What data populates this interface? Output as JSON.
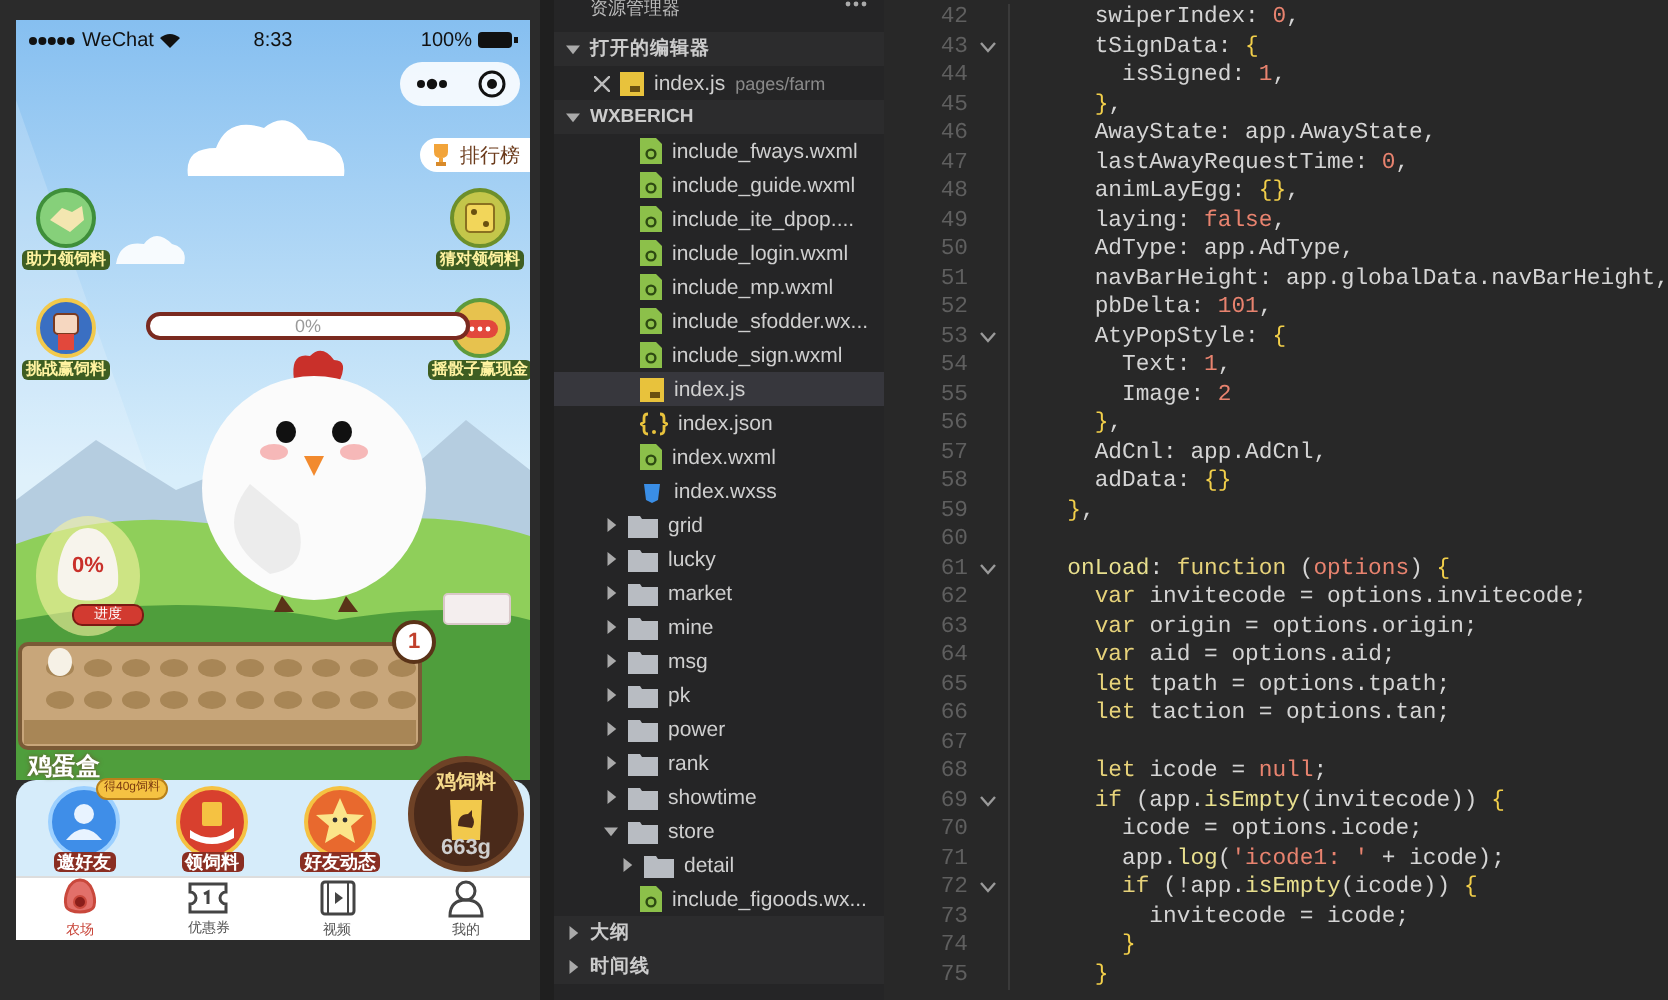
{
  "phone": {
    "status_bar": {
      "carrier": "WeChat",
      "time": "8:33",
      "battery": "100%"
    },
    "rank_button": "排行榜",
    "left_buttons": [
      {
        "kind": "handshake",
        "label": "助力领饲料"
      },
      {
        "kind": "fist",
        "label": "挑战赢饲料"
      }
    ],
    "right_buttons": [
      {
        "kind": "dice",
        "label": "猜对领饲料"
      },
      {
        "kind": "chat",
        "label": "摇骰子赢现金"
      }
    ],
    "progress": {
      "text": "0%",
      "level": 0
    },
    "egg": {
      "text": "0%",
      "label": "进度"
    },
    "tray": {
      "label": "鸡蛋盒",
      "badge": "1"
    },
    "feed": {
      "title": "鸡饲料",
      "amount": "663g"
    },
    "actions": [
      {
        "kind": "invite",
        "label": "邀好友",
        "badge": "得40g饲料"
      },
      {
        "kind": "feed",
        "label": "领饲料"
      },
      {
        "kind": "moments",
        "label": "好友动态"
      }
    ],
    "tab_bar": [
      {
        "kind": "farm",
        "label": "农场",
        "selected": true
      },
      {
        "kind": "coupon",
        "label": "优惠券",
        "selected": false
      },
      {
        "kind": "video",
        "label": "视频",
        "selected": false
      },
      {
        "kind": "profile",
        "label": "我的",
        "selected": false
      }
    ]
  },
  "explorer": {
    "title": "资源管理器",
    "open_editors": {
      "title": "打开的编辑器",
      "expanded": true,
      "files": [
        {
          "name": "index.js",
          "path": "pages/farm",
          "kind": "js"
        }
      ]
    },
    "project": {
      "title": "WXBERICH",
      "expanded": true,
      "scrolled_folder_children": [
        {
          "name": "include_fways.wxml",
          "kind": "wxml",
          "selected": false
        },
        {
          "name": "include_guide.wxml",
          "kind": "wxml",
          "selected": false
        },
        {
          "name": "include_ite_dpop....",
          "kind": "wxml",
          "selected": false
        },
        {
          "name": "include_login.wxml",
          "kind": "wxml",
          "selected": false
        },
        {
          "name": "include_mp.wxml",
          "kind": "wxml",
          "selected": false
        },
        {
          "name": "include_sfodder.wx...",
          "kind": "wxml",
          "selected": false
        },
        {
          "name": "include_sign.wxml",
          "kind": "wxml",
          "selected": false
        },
        {
          "name": "index.js",
          "kind": "js",
          "selected": true
        },
        {
          "name": "index.json",
          "kind": "json",
          "selected": false
        },
        {
          "name": "index.wxml",
          "kind": "wxml",
          "selected": false
        },
        {
          "name": "index.wxss",
          "kind": "wxss",
          "selected": false
        }
      ],
      "items": [
        {
          "name": "grid",
          "kind": "folder",
          "expanded": false,
          "selected": false
        },
        {
          "name": "lucky",
          "kind": "folder",
          "expanded": false,
          "selected": false
        },
        {
          "name": "market",
          "kind": "folder",
          "expanded": false,
          "selected": false
        },
        {
          "name": "mine",
          "kind": "folder",
          "expanded": false,
          "selected": false
        },
        {
          "name": "msg",
          "kind": "folder",
          "expanded": false,
          "selected": false
        },
        {
          "name": "pk",
          "kind": "folder",
          "expanded": false,
          "selected": false
        },
        {
          "name": "power",
          "kind": "folder",
          "expanded": false,
          "selected": false
        },
        {
          "name": "rank",
          "kind": "folder",
          "expanded": false,
          "selected": false
        },
        {
          "name": "showtime",
          "kind": "folder",
          "expanded": false,
          "selected": false
        },
        {
          "name": "store",
          "kind": "folder",
          "expanded": true,
          "selected": false,
          "children": [
            {
              "name": "detail",
              "kind": "folder",
              "expanded": false,
              "selected": false
            },
            {
              "name": "include_figoods.wx...",
              "kind": "wxml",
              "selected": false
            }
          ]
        }
      ]
    },
    "panels": [
      {
        "title": "大纲",
        "expanded": false
      },
      {
        "title": "时间线",
        "expanded": false
      }
    ]
  },
  "editor": {
    "lines": [
      {
        "number": "42",
        "fold": false,
        "segments": [
          {
            "text": "    swiperIndex: ",
            "kind": "plain"
          },
          {
            "text": "0",
            "kind": "literal"
          },
          {
            "text": ",",
            "kind": "plain"
          }
        ]
      },
      {
        "number": "43",
        "fold": true,
        "segments": [
          {
            "text": "    tSignData: ",
            "kind": "plain"
          },
          {
            "text": "{",
            "kind": "brace"
          }
        ]
      },
      {
        "number": "44",
        "fold": false,
        "segments": [
          {
            "text": "      isSigned: ",
            "kind": "plain"
          },
          {
            "text": "1",
            "kind": "literal"
          },
          {
            "text": ",",
            "kind": "plain"
          }
        ]
      },
      {
        "number": "45",
        "fold": false,
        "segments": [
          {
            "text": "    }",
            "kind": "brace"
          },
          {
            "text": ",",
            "kind": "plain"
          }
        ]
      },
      {
        "number": "46",
        "fold": false,
        "segments": [
          {
            "text": "    AwayState: app.AwayState,",
            "kind": "plain"
          }
        ]
      },
      {
        "number": "47",
        "fold": false,
        "segments": [
          {
            "text": "    lastAwayRequestTime: ",
            "kind": "plain"
          },
          {
            "text": "0",
            "kind": "literal"
          },
          {
            "text": ",",
            "kind": "plain"
          }
        ]
      },
      {
        "number": "48",
        "fold": false,
        "segments": [
          {
            "text": "    animLayEgg: ",
            "kind": "plain"
          },
          {
            "text": "{}",
            "kind": "brace"
          },
          {
            "text": ",",
            "kind": "plain"
          }
        ]
      },
      {
        "number": "49",
        "fold": false,
        "segments": [
          {
            "text": "    laying: ",
            "kind": "plain"
          },
          {
            "text": "false",
            "kind": "literal"
          },
          {
            "text": ",",
            "kind": "plain"
          }
        ]
      },
      {
        "number": "50",
        "fold": false,
        "segments": [
          {
            "text": "    AdType: app.AdType,",
            "kind": "plain"
          }
        ]
      },
      {
        "number": "51",
        "fold": false,
        "segments": [
          {
            "text": "    navBarHeight: app.globalData.navBarHeight,",
            "kind": "plain"
          }
        ]
      },
      {
        "number": "52",
        "fold": false,
        "segments": [
          {
            "text": "    pbDelta: ",
            "kind": "plain"
          },
          {
            "text": "101",
            "kind": "literal"
          },
          {
            "text": ",",
            "kind": "plain"
          }
        ]
      },
      {
        "number": "53",
        "fold": true,
        "segments": [
          {
            "text": "    AtyPopStyle: ",
            "kind": "plain"
          },
          {
            "text": "{",
            "kind": "brace"
          }
        ]
      },
      {
        "number": "54",
        "fold": false,
        "segments": [
          {
            "text": "      Text: ",
            "kind": "plain"
          },
          {
            "text": "1",
            "kind": "literal"
          },
          {
            "text": ",",
            "kind": "plain"
          }
        ]
      },
      {
        "number": "55",
        "fold": false,
        "segments": [
          {
            "text": "      Image: ",
            "kind": "plain"
          },
          {
            "text": "2",
            "kind": "literal"
          }
        ]
      },
      {
        "number": "56",
        "fold": false,
        "segments": [
          {
            "text": "    }",
            "kind": "brace"
          },
          {
            "text": ",",
            "kind": "plain"
          }
        ]
      },
      {
        "number": "57",
        "fold": false,
        "segments": [
          {
            "text": "    AdCnl: app.AdCnl,",
            "kind": "plain"
          }
        ]
      },
      {
        "number": "58",
        "fold": false,
        "segments": [
          {
            "text": "    adData: ",
            "kind": "plain"
          },
          {
            "text": "{}",
            "kind": "brace"
          }
        ]
      },
      {
        "number": "59",
        "fold": false,
        "segments": [
          {
            "text": "  }",
            "kind": "brace"
          },
          {
            "text": ",",
            "kind": "plain"
          }
        ]
      },
      {
        "number": "60",
        "fold": false
      },
      {
        "number": "61",
        "fold": true,
        "segments": [
          {
            "text": "  onLoad",
            "kind": "call"
          },
          {
            "text": ": ",
            "kind": "plain"
          },
          {
            "text": "function",
            "kind": "keyword"
          },
          {
            "text": " (",
            "kind": "plain"
          },
          {
            "text": "options",
            "kind": "literal"
          },
          {
            "text": ") ",
            "kind": "plain"
          },
          {
            "text": "{",
            "kind": "brace"
          }
        ]
      },
      {
        "number": "62",
        "fold": false,
        "segments": [
          {
            "text": "    var",
            "kind": "keyword"
          },
          {
            "text": " invitecode = options.invitecode;",
            "kind": "plain"
          }
        ]
      },
      {
        "number": "63",
        "fold": false,
        "segments": [
          {
            "text": "    var",
            "kind": "keyword"
          },
          {
            "text": " origin = options.origin;",
            "kind": "plain"
          }
        ]
      },
      {
        "number": "64",
        "fold": false,
        "segments": [
          {
            "text": "    var",
            "kind": "keyword"
          },
          {
            "text": " aid = options.aid;",
            "kind": "plain"
          }
        ]
      },
      {
        "number": "65",
        "fold": false,
        "segments": [
          {
            "text": "    let",
            "kind": "keyword"
          },
          {
            "text": " tpath = options.tpath;",
            "kind": "plain"
          }
        ]
      },
      {
        "number": "66",
        "fold": false,
        "segments": [
          {
            "text": "    let",
            "kind": "keyword"
          },
          {
            "text": " taction = options.tan;",
            "kind": "plain"
          }
        ]
      },
      {
        "number": "67",
        "fold": false
      },
      {
        "number": "68",
        "fold": false,
        "segments": [
          {
            "text": "    let",
            "kind": "keyword"
          },
          {
            "text": " icode = ",
            "kind": "plain"
          },
          {
            "text": "null",
            "kind": "literal"
          },
          {
            "text": ";",
            "kind": "plain"
          }
        ]
      },
      {
        "number": "69",
        "fold": true,
        "segments": [
          {
            "text": "    if",
            "kind": "keyword"
          },
          {
            "text": " (app.",
            "kind": "plain"
          },
          {
            "text": "isEmpty",
            "kind": "call"
          },
          {
            "text": "(invitecode)) ",
            "kind": "plain"
          },
          {
            "text": "{",
            "kind": "brace"
          }
        ]
      },
      {
        "number": "70",
        "fold": false,
        "segments": [
          {
            "text": "      icode = options.icode;",
            "kind": "plain"
          }
        ]
      },
      {
        "number": "71",
        "fold": false,
        "segments": [
          {
            "text": "      app.",
            "kind": "plain"
          },
          {
            "text": "log",
            "kind": "call"
          },
          {
            "text": "(",
            "kind": "plain"
          },
          {
            "text": "'icode1: '",
            "kind": "literal"
          },
          {
            "text": " + icode);",
            "kind": "plain"
          }
        ]
      },
      {
        "number": "72",
        "fold": true,
        "segments": [
          {
            "text": "      if",
            "kind": "keyword"
          },
          {
            "text": " (!app.",
            "kind": "plain"
          },
          {
            "text": "isEmpty",
            "kind": "call"
          },
          {
            "text": "(icode)) ",
            "kind": "plain"
          },
          {
            "text": "{",
            "kind": "brace"
          }
        ]
      },
      {
        "number": "73",
        "fold": false,
        "segments": [
          {
            "text": "        invitecode = icode;",
            "kind": "plain"
          }
        ]
      },
      {
        "number": "74",
        "fold": false,
        "segments": [
          {
            "text": "      }",
            "kind": "brace"
          }
        ]
      },
      {
        "number": "75",
        "fold": false,
        "segments": [
          {
            "text": "    }",
            "kind": "brace"
          }
        ]
      }
    ]
  }
}
